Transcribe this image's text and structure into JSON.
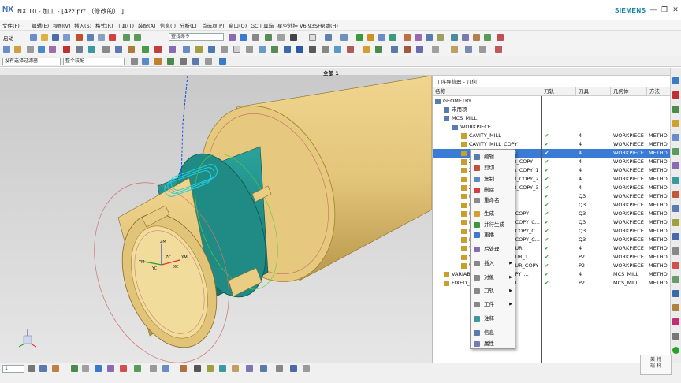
{
  "window": {
    "logo": "NX",
    "title": "NX 10 - 加工 - [4zz.prt （修改的） ]",
    "brand": "SIEMENS",
    "controls": [
      "—",
      "❐",
      "✕"
    ]
  },
  "menubar": [
    "文件(F)",
    "编辑(E)",
    "视图(V)",
    "插入(S)",
    "格式(R)",
    "工具(T)",
    "装配(A)",
    "信息(I)",
    "分析(L)",
    "首选项(P)",
    "窗口(O)",
    "GC工具箱",
    "星空外挂 V6.93SF",
    "帮助(H)"
  ],
  "toolbar": {
    "start_label": "启动",
    "command_search_placeholder": "查找命令",
    "filter_value": "没有选择过滤器",
    "assembly_value": "整个装配",
    "mode_value": "1"
  },
  "viewport": {
    "title": "全部 1",
    "triad_labels": [
      "ZM",
      "YM",
      "XM",
      "ZC",
      "YC",
      "XC"
    ]
  },
  "navigator": {
    "title": "工序导航器 - 几何",
    "columns": [
      "名称",
      "刀轨",
      "刀具",
      "几何体",
      "方法"
    ],
    "rows": [
      {
        "name": "GEOMETRY",
        "path": "",
        "tool": "",
        "geom": "",
        "method": "",
        "indent": 0,
        "check": false
      },
      {
        "name": "未用项",
        "path": "",
        "tool": "",
        "geom": "",
        "method": "",
        "indent": 1,
        "check": false
      },
      {
        "name": "MCS_MILL",
        "path": "",
        "tool": "",
        "geom": "",
        "method": "",
        "indent": 1,
        "check": false
      },
      {
        "name": "WORKPIECE",
        "path": "",
        "tool": "",
        "geom": "",
        "method": "",
        "indent": 2,
        "check": false
      },
      {
        "name": "CAVITY_MILL",
        "path": "✔",
        "tool": "4",
        "geom": "WORKPIECE",
        "method": "METHO",
        "indent": 3,
        "check": true
      },
      {
        "name": "CAVITY_MILL_COPY",
        "path": "✔",
        "tool": "4",
        "geom": "WORKPIECE",
        "method": "METHO",
        "indent": 3,
        "check": true
      },
      {
        "name": "ZLEVEL_CONTOUR",
        "path": "✔",
        "tool": "4",
        "geom": "WORKPIECE",
        "method": "METHO",
        "indent": 3,
        "check": true
      },
      {
        "name": "ZLEVEL_CONTOUR_COPY",
        "path": "✔",
        "tool": "4",
        "geom": "WORKPIECE",
        "method": "METHO",
        "indent": 3,
        "check": true
      },
      {
        "name": "ZLEVEL_CONTOUR_COPY_1",
        "path": "✔",
        "tool": "4",
        "geom": "WORKPIECE",
        "method": "METHO",
        "indent": 3,
        "check": true
      },
      {
        "name": "ZLEVEL_CONTOUR_COPY_2",
        "path": "✔",
        "tool": "4",
        "geom": "WORKPIECE",
        "method": "METHO",
        "indent": 3,
        "check": true
      },
      {
        "name": "ZLEVEL_CONTOUR_COPY_3",
        "path": "✔",
        "tool": "4",
        "geom": "WORKPIECE",
        "method": "METHO",
        "indent": 3,
        "check": true
      },
      {
        "name": "REST_MILLING",
        "path": "✔",
        "tool": "Q3",
        "geom": "WORKPIECE",
        "method": "METHO",
        "indent": 3,
        "check": true
      },
      {
        "name": "FIXED_CONTOUR",
        "path": "✔",
        "tool": "Q3",
        "geom": "WORKPIECE",
        "method": "METHO",
        "indent": 3,
        "check": true
      },
      {
        "name": "FIXED_CONTOUR_COPY",
        "path": "✔",
        "tool": "Q3",
        "geom": "WORKPIECE",
        "method": "METHO",
        "indent": 3,
        "check": true
      },
      {
        "name": "FIXED_CONTOUR_COPY_C...",
        "path": "✔",
        "tool": "Q3",
        "geom": "WORKPIECE",
        "method": "METHO",
        "indent": 3,
        "check": true
      },
      {
        "name": "FIXED_CONTOUR_COPY_C...",
        "path": "✔",
        "tool": "Q3",
        "geom": "WORKPIECE",
        "method": "METHO",
        "indent": 3,
        "check": true
      },
      {
        "name": "FIXED_CONTOUR_COPY_C...",
        "path": "✔",
        "tool": "Q3",
        "geom": "WORKPIECE",
        "method": "METHO",
        "indent": 3,
        "check": true
      },
      {
        "name": "VARIABLE_CONTOUR",
        "path": "✔",
        "tool": "4",
        "geom": "WORKPIECE",
        "method": "METHO",
        "indent": 3,
        "check": true
      },
      {
        "name": "VARIABLE_CONTOUR_1",
        "path": "✔",
        "tool": "P2",
        "geom": "WORKPIECE",
        "method": "METHO",
        "indent": 3,
        "check": true
      },
      {
        "name": "VARIABLE_CONTOUR_COPY",
        "path": "✔",
        "tool": "P2",
        "geom": "WORKPIECE",
        "method": "METHO",
        "indent": 3,
        "check": true
      },
      {
        "name": "VARIABLE_CONTOUR_COPY_...",
        "path": "✔",
        "tool": "4",
        "geom": "MCS_MILL",
        "method": "METHO",
        "indent": 1,
        "check": true
      },
      {
        "name": "FIXED_CONTOUR_COPY_1",
        "path": "✔",
        "tool": "P2",
        "geom": "MCS_MILL",
        "method": "METHO",
        "indent": 1,
        "check": true
      }
    ],
    "selected_row": 6
  },
  "context_menu": [
    "编辑...",
    "剪切",
    "复制",
    "删除",
    "重命名",
    "生成",
    "并行生成",
    "重播",
    "后处理",
    "插入",
    "对象",
    "刀轨",
    "工件",
    "注释",
    "信息",
    "属性"
  ],
  "context_submenu": [
    false,
    false,
    false,
    false,
    false,
    false,
    false,
    false,
    false,
    true,
    true,
    true,
    true,
    false,
    false,
    false
  ],
  "watermark": {
    "line1": "莱  特",
    "line2": "瑞  科"
  },
  "colors": {
    "accent": "#3a7bd5",
    "part_tan": "#e3c57a",
    "part_teal": "#1f8b84",
    "toolpath": "#22d0e0",
    "check": "#2a9a2a"
  }
}
